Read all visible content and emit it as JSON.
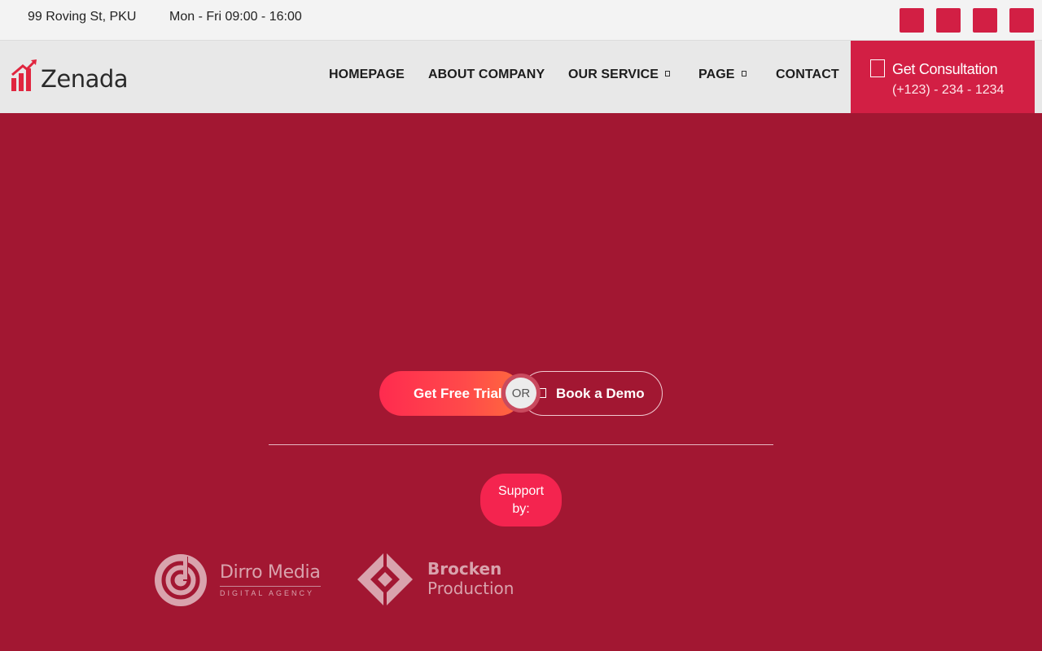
{
  "topbar": {
    "address": "99 Roving St, PKU",
    "hours": "Mon - Fri 09:00 - 16:00",
    "social_icons": [
      "social-icon-1",
      "social-icon-2",
      "social-icon-3",
      "social-icon-4"
    ]
  },
  "header": {
    "logo_text": "Zenada",
    "nav": [
      {
        "label": "HOMEPAGE"
      },
      {
        "label": "ABOUT COMPANY"
      },
      {
        "label": "OUR SERVICE"
      },
      {
        "label": "PAGE"
      },
      {
        "label": "CONTACT"
      }
    ],
    "cta": {
      "title": "Get Consultation",
      "phone": "(+123) - 234 - 1234"
    }
  },
  "hero": {
    "trial_label": "Get Free Trial",
    "or_label": "OR",
    "demo_label": "Book a Demo",
    "support_label": "Support by:"
  },
  "partners": {
    "dirro": {
      "name": "Dirro Media",
      "tagline": "DIGITAL AGENCY"
    },
    "brocken": {
      "line1": "Brocken",
      "line2": "Production"
    }
  },
  "colors": {
    "brand_red": "#d21f44",
    "background": "#a21732",
    "header_bg": "#e8e8e8"
  }
}
